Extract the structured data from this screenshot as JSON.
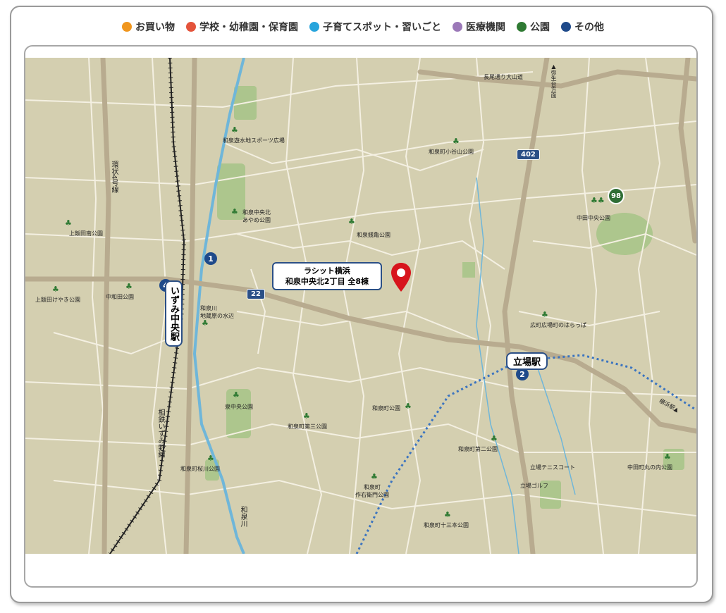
{
  "legend": [
    {
      "label": "お買い物",
      "color": "#f0961e"
    },
    {
      "label": "学校・幼稚園・保育園",
      "color": "#e4533b"
    },
    {
      "label": "子育てスポット・習いごと",
      "color": "#27a4dc"
    },
    {
      "label": "医療機関",
      "color": "#9b78b8"
    },
    {
      "label": "公園",
      "color": "#2f7a33"
    },
    {
      "label": "その他",
      "color": "#1f4a8a"
    }
  ],
  "property": {
    "line1": "ラシット横浜",
    "line2": "和泉中央北2丁目 全8棟"
  },
  "stations": {
    "izumi_chuo": "いずみ中央駅",
    "tateba": "立場駅"
  },
  "badges": {
    "b1": "1",
    "b2": "2",
    "b4": "4",
    "b98": "98"
  },
  "routes": {
    "r22": "22",
    "r402": "402"
  },
  "labels": {
    "kanjo": "環状4号線",
    "sotetsu": "相鉄いずみ野線",
    "izumigawa": "和泉川",
    "izumi_sports": "和泉遊水地スポーツ広場",
    "koyama": "和泉町小谷山公園",
    "ayame": "和泉中央北\nあやめ公園",
    "zeni": "和泉銭亀公園",
    "kamiiida_minami": "上飯田南公園",
    "kamiiida_keyaki": "上飯田けやき公園",
    "nakawada": "中和田公園",
    "mizube": "和泉川\n地蔵原の水辺",
    "nakata_chuo": "中田中央公園",
    "hiromachi": "広町広場町のはらっぱ",
    "izumi_chuo_park": "泉中央公園",
    "izumimachi_park": "和泉町公園",
    "daisan": "和泉町第三公園",
    "daini": "和泉町第二公園",
    "tennis": "立場テニスコート",
    "golf": "立場ゴルフ",
    "nakata_maru": "中田町丸の内公園",
    "sakuragawa": "和泉町桜川公園",
    "sakuemon": "和泉町\n作右衛門公園",
    "jusanbon": "和泉町十三本公園",
    "nagao": "長尾通り大山道",
    "yayoi": "▲弥生台方面",
    "yokohama": "横浜駅▲"
  }
}
